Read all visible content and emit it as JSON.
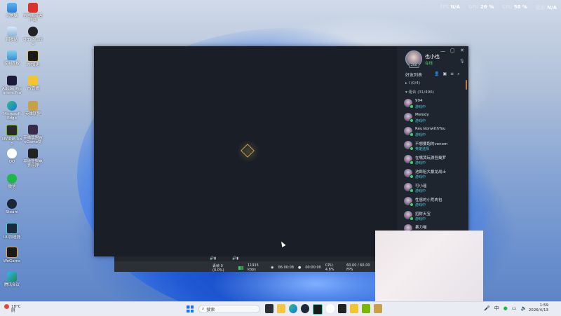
{
  "stats": {
    "fps_label": "FPS",
    "fps_value": "N/A",
    "gpu_label": "GPU",
    "gpu_value": "26 %",
    "cpu_label": "CPU",
    "cpu_value": "58 %",
    "mem_label": "延迟",
    "mem_value": "N/A"
  },
  "desktop_icons": {
    "i0": "此电脑",
    "i1": "吉吉影音客户端",
    "i2": "回收站",
    "i3": "OBS Studio",
    "i4": "控制面板",
    "i5": "PP加速",
    "i6": "Adobe Premiere Pro",
    "i7": "YY直播",
    "i8": "Microsoft Edge",
    "i9": "英雄联盟",
    "i10": "NVIDIA App",
    "i11": "英雄联盟WeGame版",
    "i12": "QQ",
    "i13": "英雄联盟电竞经理",
    "i14": "微信",
    "i15": "Steam",
    "i16": "UU加速器",
    "i17": "WeGame",
    "i18": "腾讯会议"
  },
  "launcher": {
    "window_controls": {
      "min": "—",
      "max": "▢",
      "restore": "⚙",
      "close": "✕"
    },
    "profile": {
      "name": "也小也",
      "status": "在线",
      "level": "200"
    },
    "friends_header": "好友列表",
    "groups": [
      {
        "label": "I (0/4)"
      },
      {
        "label": "组合 (31/496)"
      }
    ],
    "friends": [
      {
        "name": "994",
        "status": "游戏中"
      },
      {
        "name": "Melody",
        "status": "游戏中"
      },
      {
        "name": "ReunionwithYou",
        "status": "游戏中"
      },
      {
        "name": "不想要跑的venom",
        "status": "英雄选择"
      },
      {
        "name": "在嘴哭玩淵吾幾罗",
        "status": "游戏中"
      },
      {
        "name": "池郎阻大暴龙战士",
        "status": "游戏中"
      },
      {
        "name": "可小瑶",
        "status": "游戏中"
      },
      {
        "name": "性感的小荒肉包",
        "status": "游戏中"
      },
      {
        "name": "招财天宝",
        "status": "游戏中"
      },
      {
        "name": "暴力喵",
        "status": ""
      }
    ]
  },
  "obs": {
    "frames": "丢帧 0 (0.0%)",
    "bitrate": "11915 kbps",
    "rec_time": "06:00:08",
    "stream_time": "00:00:00",
    "cpu": "CPU: 4.8%",
    "fps": "60.00 / 60.00 FPS"
  },
  "taskbar": {
    "weather_temp": "18°C",
    "weather_desc": "阴",
    "search_placeholder": "搜索",
    "ime": "中",
    "time": "1:59",
    "date": "2026/4/13"
  },
  "colors": {
    "accent_blue": "#1a73e8",
    "online_green": "#3fd46b",
    "ingame_cyan": "#4cc9d9",
    "launcher_bg": "#1a1f27"
  }
}
